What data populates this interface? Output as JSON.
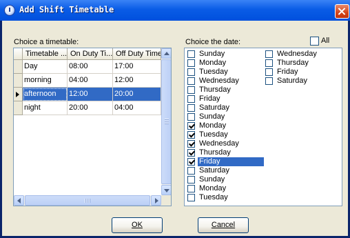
{
  "window": {
    "title": "Add Shift Timetable",
    "close_label": "×"
  },
  "timetable": {
    "label": "Choice a timetable:",
    "columns": [
      "Timetable ...",
      "On Duty Ti...",
      "Off Duty Time"
    ],
    "rows": [
      {
        "name": "Day",
        "on": "08:00",
        "off": "17:00"
      },
      {
        "name": "morning",
        "on": "04:00",
        "off": "12:00"
      },
      {
        "name": "afternoon",
        "on": "12:00",
        "off": "20:00"
      },
      {
        "name": "night",
        "on": "20:00",
        "off": "04:00"
      }
    ],
    "selected_row": 2
  },
  "dates": {
    "label": "Choice the date:",
    "all_label": "All",
    "all_checked": false,
    "column1": [
      {
        "label": "Sunday",
        "checked": false
      },
      {
        "label": "Monday",
        "checked": false
      },
      {
        "label": "Tuesday",
        "checked": false
      },
      {
        "label": "Wednesday",
        "checked": false
      },
      {
        "label": "Thursday",
        "checked": false
      },
      {
        "label": "Friday",
        "checked": false
      },
      {
        "label": "Saturday",
        "checked": false
      },
      {
        "label": "Sunday",
        "checked": false
      },
      {
        "label": "Monday",
        "checked": true
      },
      {
        "label": "Tuesday",
        "checked": true
      },
      {
        "label": "Wednesday",
        "checked": true
      },
      {
        "label": "Thursday",
        "checked": true
      },
      {
        "label": "Friday",
        "checked": true,
        "highlighted": true
      },
      {
        "label": "Saturday",
        "checked": false
      },
      {
        "label": "Sunday",
        "checked": false
      },
      {
        "label": "Monday",
        "checked": false
      },
      {
        "label": "Tuesday",
        "checked": false
      }
    ],
    "column2": [
      {
        "label": "Wednesday",
        "checked": false
      },
      {
        "label": "Thursday",
        "checked": false
      },
      {
        "label": "Friday",
        "checked": false
      },
      {
        "label": "Saturday",
        "checked": false
      }
    ]
  },
  "buttons": {
    "ok": "OK",
    "cancel": "Cancel"
  },
  "colors": {
    "selection": "#316ac5",
    "title_bar": "#0a5ce6",
    "dialog_bg": "#ece9d8"
  }
}
